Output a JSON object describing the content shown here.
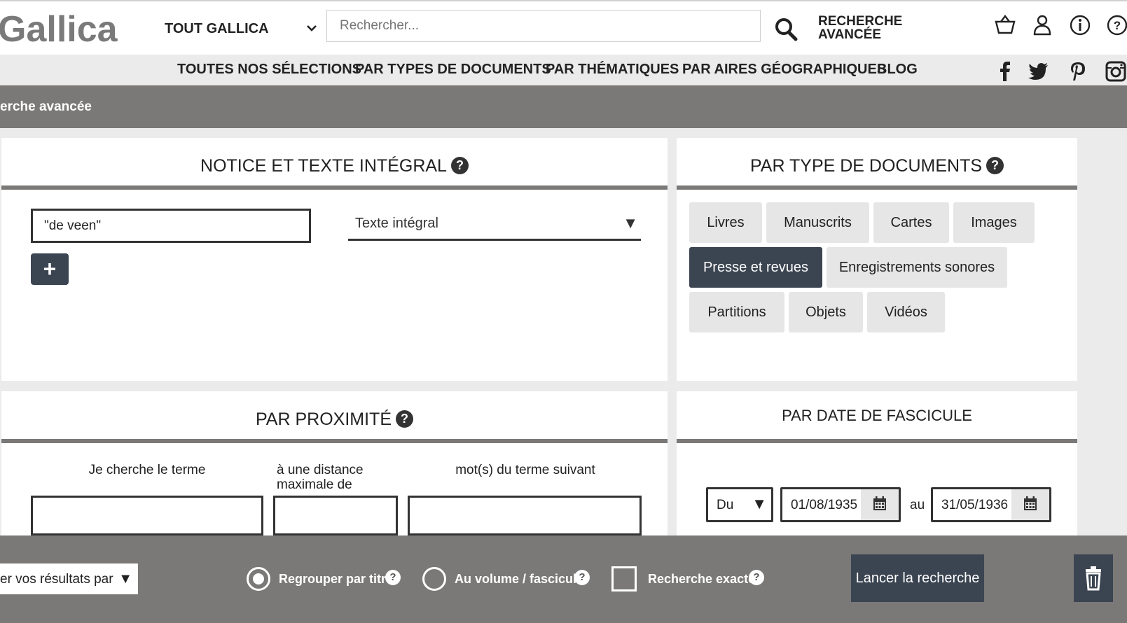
{
  "header": {
    "logo": "Gallica",
    "scope_label": "TOUT GALLICA",
    "search_placeholder": "Rechercher...",
    "advanced_line1": "RECHERCHE",
    "advanced_line2": "AVANCÉE"
  },
  "nav": {
    "items": [
      "TOUTES NOS SÉLECTIONS",
      "PAR TYPES DE DOCUMENTS",
      "PAR THÉMATIQUES",
      "PAR AIRES GÉOGRAPHIQUES",
      "BLOG"
    ]
  },
  "breadcrumb": "erche avancée",
  "notice_panel": {
    "title": "NOTICE ET TEXTE INTÉGRAL",
    "query_value": "\"de veen\"",
    "field_select": "Texte intégral",
    "add_label": "+"
  },
  "type_panel": {
    "title": "PAR TYPE DE DOCUMENTS",
    "types": [
      "Livres",
      "Manuscrits",
      "Cartes",
      "Images",
      "Presse et revues",
      "Enregistrements sonores",
      "Partitions",
      "Objets",
      "Vidéos"
    ],
    "active": "Presse et revues"
  },
  "proximity_panel": {
    "title": "PAR PROXIMITÉ",
    "label_term": "Je cherche le terme",
    "label_distance": "à une distance maximale de",
    "label_next": "mot(s) du terme suivant"
  },
  "date_panel": {
    "title": "PAR DATE DE FASCICULE",
    "mode": "Du",
    "from": "01/08/1935",
    "separator": "au",
    "to": "31/05/1936"
  },
  "footer": {
    "sort_label": "er vos résultats par",
    "group_by_title": "Regrouper par titre",
    "by_volume": "Au volume / fascicule",
    "exact_search": "Recherche exacte",
    "launch": "Lancer la recherche"
  },
  "colors": {
    "dark_button": "#3b4451",
    "grey_bar": "#7a7978",
    "light_button": "#e6e6e6"
  },
  "icons": [
    "chevron-down-icon",
    "search-icon",
    "basket-icon",
    "user-icon",
    "info-icon",
    "help-icon",
    "facebook-icon",
    "twitter-icon",
    "pinterest-icon",
    "instagram-icon",
    "calendar-icon",
    "trash-icon"
  ]
}
